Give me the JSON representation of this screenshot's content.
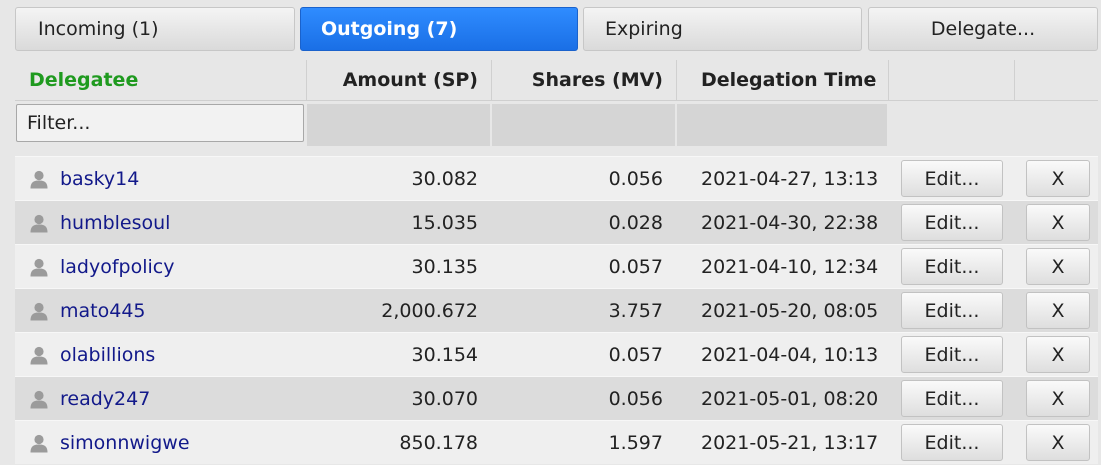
{
  "tabs": [
    {
      "label": "Incoming (1)",
      "active": false
    },
    {
      "label": "Outgoing (7)",
      "active": true
    },
    {
      "label": "Expiring",
      "active": false
    },
    {
      "label": "Delegate...",
      "active": false
    }
  ],
  "table": {
    "headers": {
      "delegatee": "Delegatee",
      "amount": "Amount (SP)",
      "shares": "Shares (MV)",
      "time": "Delegation Time"
    },
    "filter_placeholder": "Filter...",
    "edit_label": "Edit...",
    "remove_label": "X",
    "rows": [
      {
        "user": "basky14",
        "amount": "30.082",
        "shares": "0.056",
        "time": "2021-04-27, 13:13"
      },
      {
        "user": "humblesoul",
        "amount": "15.035",
        "shares": "0.028",
        "time": "2021-04-30, 22:38"
      },
      {
        "user": "ladyofpolicy",
        "amount": "30.135",
        "shares": "0.057",
        "time": "2021-04-10, 12:34"
      },
      {
        "user": "mato445",
        "amount": "2,000.672",
        "shares": "3.757",
        "time": "2021-05-20, 08:05"
      },
      {
        "user": "olabillions",
        "amount": "30.154",
        "shares": "0.057",
        "time": "2021-04-04, 10:13"
      },
      {
        "user": "ready247",
        "amount": "30.070",
        "shares": "0.056",
        "time": "2021-05-01, 08:20"
      },
      {
        "user": "simonnwigwe",
        "amount": "850.178",
        "shares": "1.597",
        "time": "2021-05-21, 13:17"
      }
    ]
  },
  "colors": {
    "active_tab": "#1a6fe6",
    "delegatee_header": "#1f9a1f",
    "username_link": "#12198a"
  },
  "icons": {
    "user": "user-icon"
  }
}
